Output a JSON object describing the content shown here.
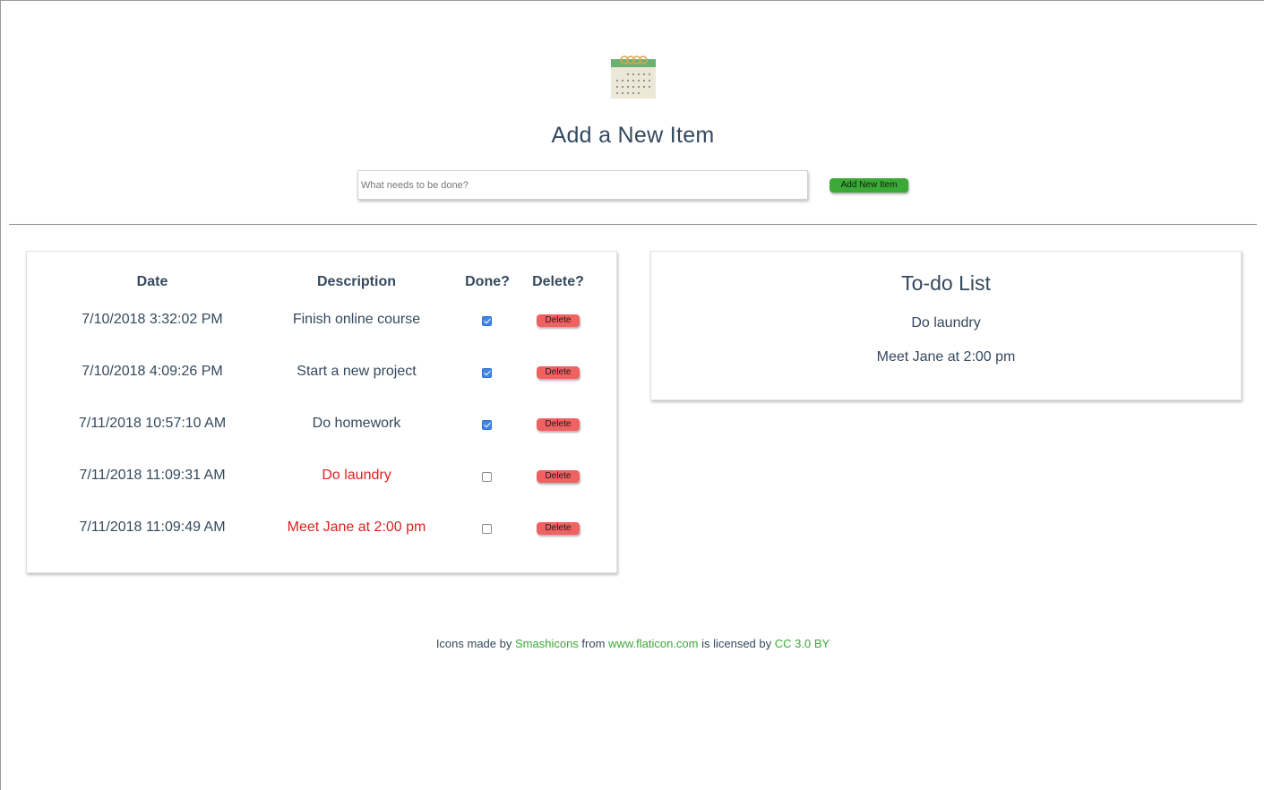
{
  "header": {
    "title": "Add a New Item",
    "input_placeholder": "What needs to be done?",
    "input_value": "",
    "add_button_label": "Add New Item"
  },
  "items_table": {
    "columns": [
      "Date",
      "Description",
      "Done?",
      "Delete?"
    ],
    "delete_label": "Delete",
    "rows": [
      {
        "date": "7/10/2018 3:32:02 PM",
        "description": "Finish online course",
        "done": true
      },
      {
        "date": "7/10/2018 4:09:26 PM",
        "description": "Start a new project",
        "done": true
      },
      {
        "date": "7/11/2018 10:57:10 AM",
        "description": "Do homework",
        "done": true
      },
      {
        "date": "7/11/2018 11:09:31 AM",
        "description": "Do laundry",
        "done": false
      },
      {
        "date": "7/11/2018 11:09:49 AM",
        "description": "Meet Jane at 2:00 pm",
        "done": false
      }
    ]
  },
  "todo_list": {
    "title": "To-do List",
    "items": [
      "Do laundry",
      "Meet Jane at 2:00 pm"
    ]
  },
  "footer": {
    "text_1": "Icons made by",
    "link_author": "Smashicons",
    "text_2": "from",
    "link_site": "www.flaticon.com",
    "text_3": "is licensed by",
    "link_license": "CC 3.0 BY"
  },
  "icons": {
    "header_icon": "calendar-icon"
  },
  "colors": {
    "primary_text": "#34495e",
    "add_button": "#3aa935",
    "delete_button": "#f06161",
    "pending_item": "#e02020",
    "link": "#3aa935",
    "checkbox_checked": "#3f86e8"
  }
}
